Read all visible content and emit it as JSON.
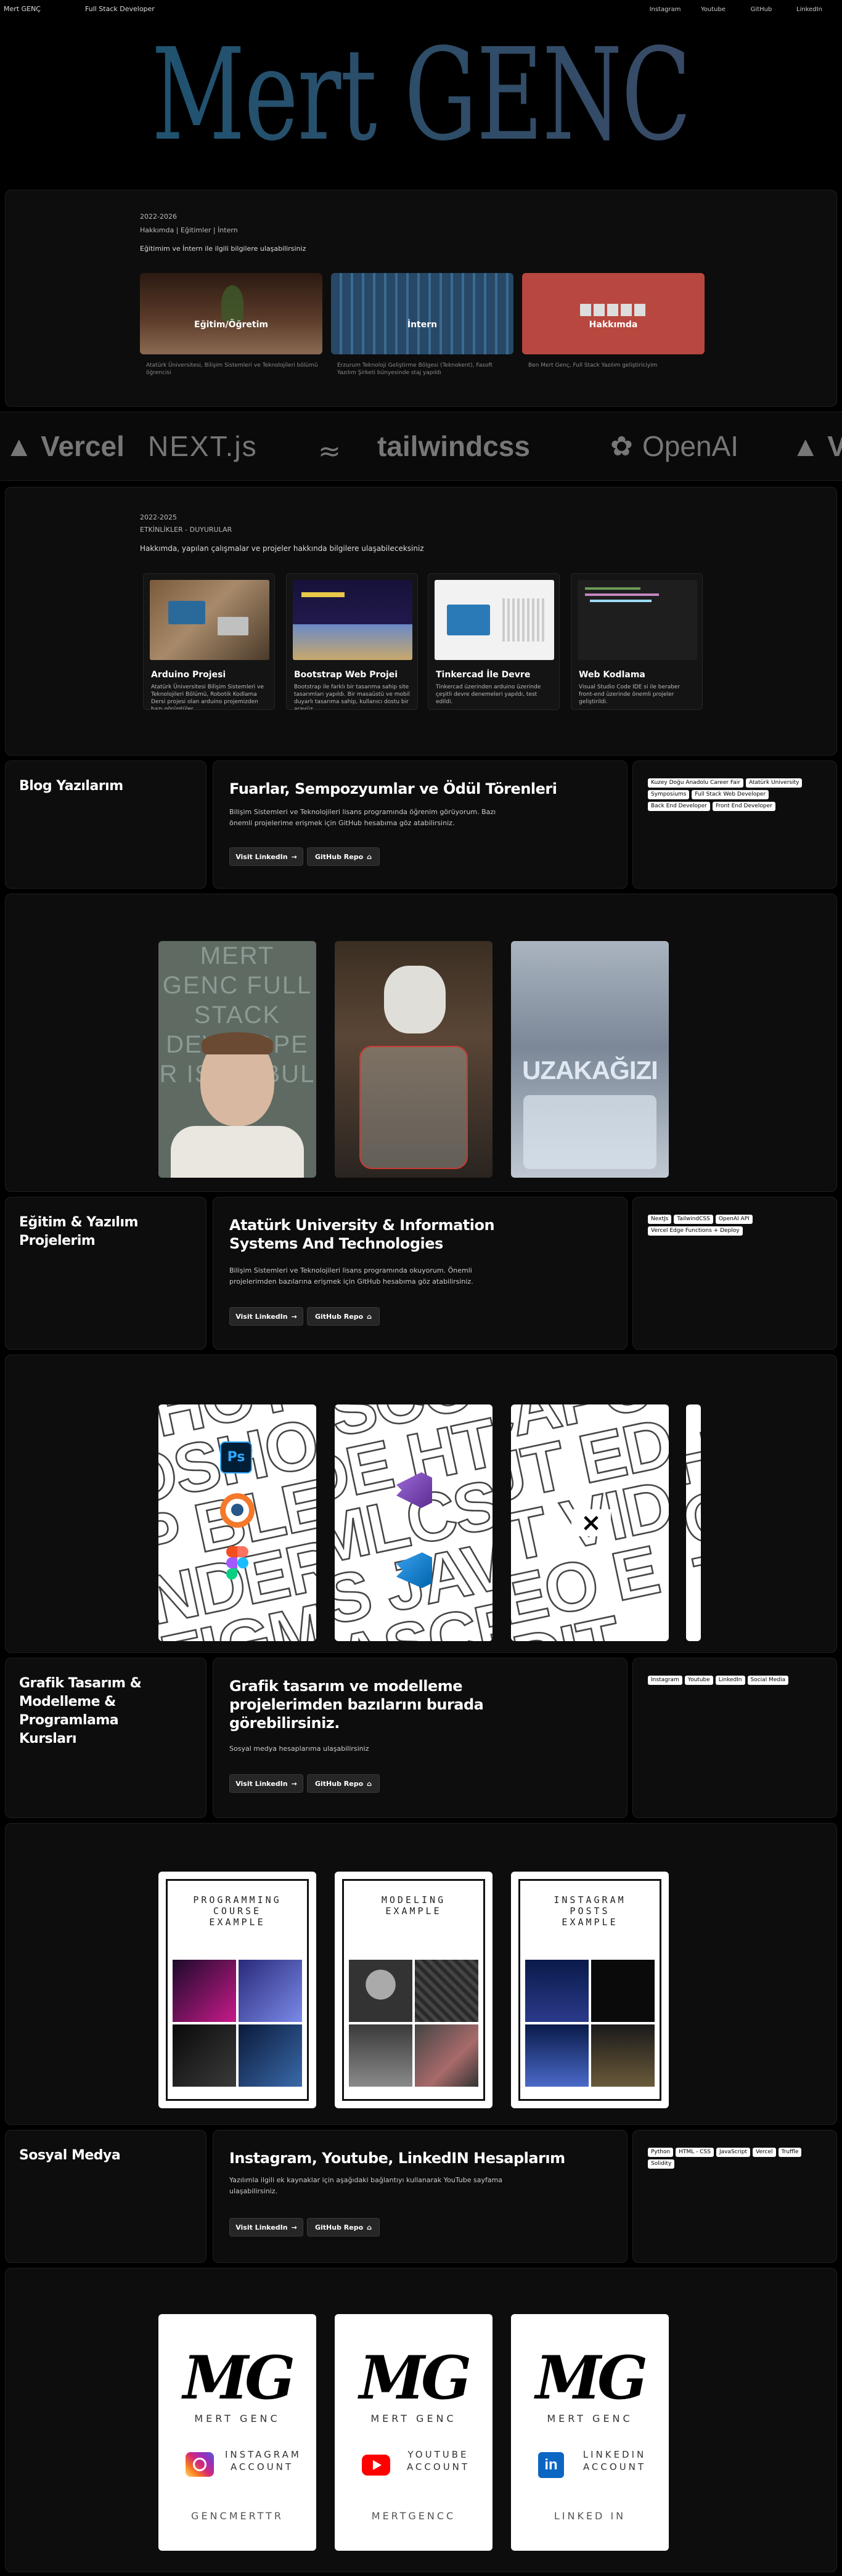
{
  "nav": {
    "brand": "Mert GENÇ",
    "role": "Full Stack Developer",
    "links": [
      "Instagram",
      "Youtube",
      "GitHub",
      "LinkedIn"
    ]
  },
  "hero": {
    "title": "Mert GENC"
  },
  "about": {
    "years": "2022-2026",
    "crumbs": "Hakkımda | Eğitimler | İntern",
    "desc": "Eğitimim ve İntern ile ilgili bilgilere ulaşabilirsiniz",
    "cards": [
      {
        "label": "Eğitim/Öğretim",
        "caption": "Atatürk Üniversitesi, Bilişim Sistemleri ve Teknolojileri bölümü öğrencisi"
      },
      {
        "label": "İntern",
        "caption": "Erzurum Teknoloji Geliştirme Bölgesi (Teknokent), Fasoft Yazılım Şirketi bünyesinde staj yapıldı"
      },
      {
        "label": "Hakkımda",
        "caption": "Ben Mert Genç, Full Stack Yazılım geliştiriciyim"
      }
    ]
  },
  "marquee": {
    "logos": [
      "▲ Vercel",
      "NEXT.js",
      "tailwindcss",
      "OpenAI",
      "▲ V"
    ]
  },
  "projects": {
    "years": "2022-2025",
    "crumbs": "ETKİNLİKLER - DUYURULAR",
    "desc": "Hakkımda, yapılan çalışmalar ve projeler hakkında bilgilere ulaşabileceksiniz",
    "cards": [
      {
        "title": "Arduino Projesi",
        "desc": "Atatürk Üniversitesi Bilişim Sistemleri ve Teknolojileri Bölümü, Robotik Kodlama Dersi projesi olan arduino projemizden bazı görüntüler."
      },
      {
        "title": "Bootstrap Web Projei",
        "desc": "Bootstrap ile farklı bir tasarıma sahip site tasarımları yapıldı. Bir masaüstü ve mobil duyarlı tasarıma sahip, kullanıcı dostu bir arayüz."
      },
      {
        "title": "Tinkercad İle Devre",
        "desc": "Tinkercad üzerinden arduino üzerinde çeşitli devre denemeleri yapıldı, test edildi."
      },
      {
        "title": "Web Kodlama",
        "desc": "Visual Studio Code IDE si ile beraber front-end üzerinde önemli projeler geliştirildi."
      }
    ]
  },
  "blog": {
    "title": "Blog Yazılarım",
    "heading": "Fuarlar, Sempozyumlar ve Ödül Törenleri",
    "desc": "Bilişim Sistemleri ve Teknolojileri lisans programında öğrenim görüyorum. Bazı önemli projelerime erişmek için GitHub hesabıma göz atabilirsiniz.",
    "btn1": "Visit LinkedIn",
    "btn2": "GitHub Repo",
    "tags": [
      "Kuzey Doğu Anadolu Career Fair",
      "Atatürk University",
      "Symposiums",
      "Full Stack Web Developer",
      "Back End Developer",
      "Front End Developer"
    ],
    "gallery_text": "MERT GENC FULL STACK DEVELOPER ISTANBUL",
    "sign_text": "UZAKAĞIZI"
  },
  "education": {
    "title": "Eğitim & Yazılım Projelerim",
    "heading": "Atatürk University & Information Systems And Technologies",
    "desc": "Bilişim Sistemleri ve Teknolojileri lisans programında okuyorum. Önemli projelerimden bazılarına erişmek için GitHub hesabıma göz atabilirsiniz.",
    "btn1": "Visit LinkedIn",
    "btn2": "GitHub Repo",
    "tags": [
      "NextJs",
      "TailwindCSS",
      "OpenAI API",
      "Vercel Edge Functions + Deploy"
    ],
    "patterns": [
      "PHOTOSHOP BLENDER FIGMA",
      "VSCODE HTMLCSS JAVASCRIPT",
      "CAPCUT EDIT VIDEO EDIT"
    ]
  },
  "design": {
    "title": "Grafik Tasarım & Modelleme & Programlama Kursları",
    "heading": "Grafik tasarım ve modelleme projelerimden bazılarını burada görebilirsiniz.",
    "desc": "Sosyal medya hesaplarıma ulaşabilirsiniz",
    "btn1": "Visit LinkedIn",
    "btn2": "GitHub Repo",
    "tags": [
      "Instagram",
      "Youtube",
      "LinkedIn",
      "Social Media"
    ],
    "frames": [
      "PROGRAMMING COURSE EXAMPLE",
      "MODELING EXAMPLE",
      "INSTAGRAM POSTS EXAMPLE"
    ]
  },
  "social": {
    "title": "Sosyal Medya",
    "heading": "Instagram, Youtube, LinkedIN Hesaplarım",
    "desc": "Yazılımla ilgili ek kaynaklar için aşağıdaki bağlantıyı kullanarak YouTube sayfama ulaşabilirsiniz.",
    "btn1": "Visit LinkedIn",
    "btn2": "GitHub Repo",
    "tags": [
      "Python",
      "HTML - CSS",
      "JavaScript",
      "Vercel",
      "Truffle",
      "Solidity"
    ],
    "cards": [
      {
        "logo": "MG",
        "name": "MERT GENC",
        "account": "INSTAGRAM ACCOUNT",
        "handle": "GENCMERTTR",
        "color": "#d6249f"
      },
      {
        "logo": "MG",
        "name": "MERT GENC",
        "account": "YOUTUBE ACCOUNT",
        "handle": "MERTGENCC",
        "color": "#ff0000"
      },
      {
        "logo": "MG",
        "name": "MERT GENC",
        "account": "LINKEDIN ACCOUNT",
        "handle": "LINKED IN",
        "color": "#0a66c2"
      }
    ]
  }
}
